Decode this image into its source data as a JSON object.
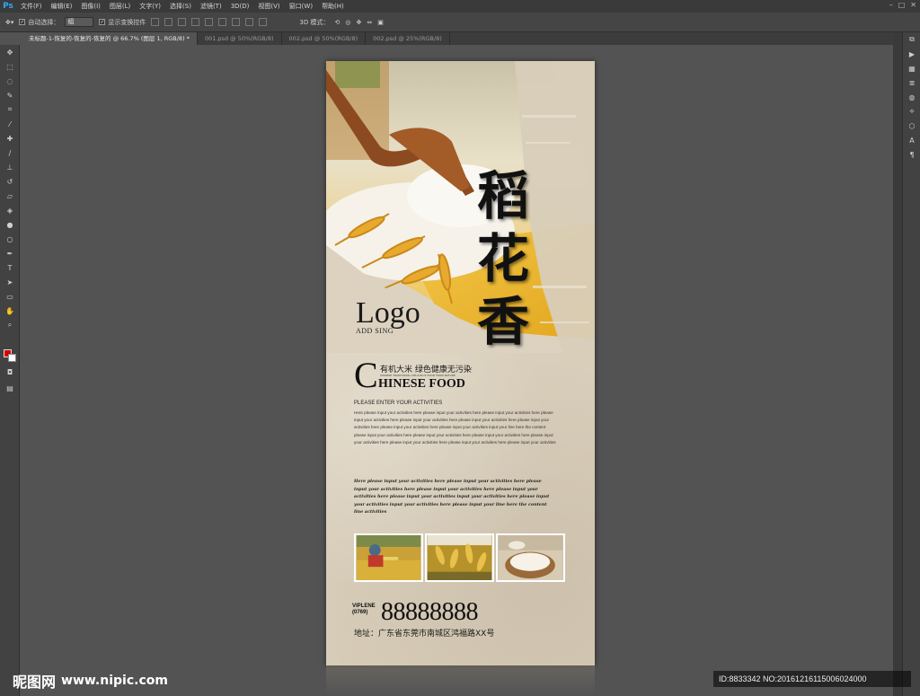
{
  "app": {
    "logo": "Ps"
  },
  "menu": [
    "文件(F)",
    "编辑(E)",
    "图像(I)",
    "图层(L)",
    "文字(Y)",
    "选择(S)",
    "滤镜(T)",
    "3D(D)",
    "视图(V)",
    "窗口(W)",
    "帮助(H)"
  ],
  "options": {
    "auto_select_label": "自动选择：",
    "auto_select_value": "组",
    "show_transform_label": "显示变换控件",
    "mode3d_label": "3D 模式："
  },
  "tabs": [
    {
      "label": "未标题-1-恢复的-恢复的-恢复的 @ 66.7% (图层 1, RGB/8) *",
      "active": true
    },
    {
      "label": "001.psd @ 50%(RGB/8)",
      "active": false
    },
    {
      "label": "002.psd @ 50%(RGB/8)",
      "active": false
    },
    {
      "label": "002.psd @ 25%(RGB/8)",
      "active": false
    }
  ],
  "poster": {
    "calligraphy": [
      "稻",
      "花",
      "香"
    ],
    "logo": "Logo",
    "logo_sub": "ADD SING",
    "big_c": "C",
    "slogan": "有机大米  绿色健康无污染",
    "small_line": "CHINESE TRADITIONAL DELICIOUS FOOD FROM NATURE",
    "chinese_food": "HINESE FOOD",
    "enter_title": "PLEASE ENTER YOUR ACTIVITIES",
    "paragraph": "Here please input your activities here please input your activities here please input your activities here please input your activities here please input your activities here please input your activities here please input your activities here please input your activities here please input your activities input your line here the content please input your activities here please input your activities here please input your activities here please input your activities here please input your activities here please input your activities here please input your activities",
    "script": "Here please input your activities here please input your activities here please input your activities here please input your activities here please input your activities here please input your activities input your activities here please input your activities input your activities here please input your line here the content line activities",
    "viplene": "VIPLENE",
    "area_code": "(0769)",
    "phone": "88888888",
    "address": "地址：广东省东莞市南城区鸿福路XX号"
  },
  "watermark": {
    "site_cn": "昵图网",
    "site_url": "www.nipic.com",
    "id_text": "ID:8833342 NO:20161216115006024000"
  },
  "colors": {
    "fg_swatch": "#d40000",
    "bg_swatch": "#ffffff",
    "accent": "#31a8ff"
  }
}
